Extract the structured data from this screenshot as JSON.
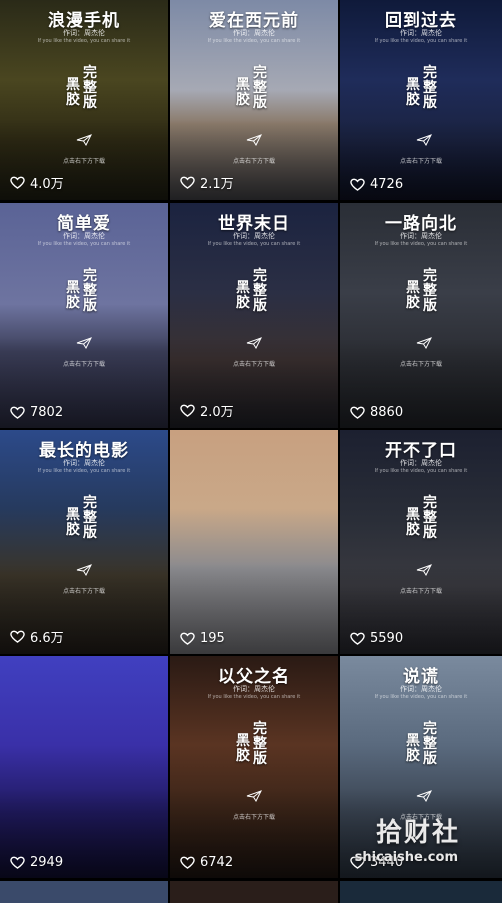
{
  "tiles": [
    {
      "title": "浪漫手机",
      "likes": "4.0万",
      "has_overlay": true,
      "bg": "linear-gradient(180deg,#2a2a18 0%,#4a4620 40%,#2e2a14 70%,#1a1a10 100%)"
    },
    {
      "title": "爱在西元前",
      "likes": "2.1万",
      "has_overlay": true,
      "bg": "linear-gradient(180deg,#7d8aa6 0%,#a6a9b4 45%,#8a7a6a 62%,#3a3a3e 100%)"
    },
    {
      "title": "回到过去",
      "likes": "4726",
      "has_overlay": true,
      "bg": "linear-gradient(180deg,#0f1a3a 0%,#1f2c5a 40%,#1a2240 70%,#0c0f1e 100%)"
    },
    {
      "title": "简单爱",
      "likes": "7802",
      "has_overlay": true,
      "bg": "linear-gradient(180deg,#5a6396 0%,#6e74a0 45%,#3c3f5a 66%,#26273a 100%)"
    },
    {
      "title": "世界末日",
      "likes": "2.0万",
      "has_overlay": true,
      "bg": "linear-gradient(180deg,#1b2340 0%,#2b2f44 40%,#3a3030 70%,#1c1c22 100%)"
    },
    {
      "title": "一路向北",
      "likes": "8860",
      "has_overlay": true,
      "bg": "linear-gradient(180deg,#2a2e36 0%,#3a3e48 40%,#2a2c32 70%,#1c1e22 100%)"
    },
    {
      "title": "最长的电影",
      "likes": "6.6万",
      "has_overlay": true,
      "bg": "linear-gradient(180deg,#2c4a8a 0%,#263a5e 35%,#3a3428 65%,#1e1a16 100%)"
    },
    {
      "title": "",
      "likes": "195",
      "has_overlay": false,
      "bg": "linear-gradient(180deg,#c8a080 0%,#c9a888 35%,#8a8a8e 62%,#6a6a6e 100%)"
    },
    {
      "title": "开不了口",
      "likes": "5590",
      "has_overlay": true,
      "bg": "linear-gradient(180deg,#1c2030 0%,#2a2e38 40%,#3a3a40 70%,#222228 100%)"
    },
    {
      "title": "",
      "likes": "2949",
      "has_overlay": false,
      "bg": "linear-gradient(180deg,#4040c0 0%,#3a30a8 40%,#201a60 70%,#0e0c2a 100%)"
    },
    {
      "title": "以父之名",
      "likes": "6742",
      "has_overlay": true,
      "bg": "linear-gradient(180deg,#2a1a14 0%,#5a3422 40%,#3a2418 70%,#1a120e 100%)"
    },
    {
      "title": "说谎",
      "likes": "3440",
      "has_overlay": true,
      "bg": "linear-gradient(180deg,#7a8a9e 0%,#5a6a7e 40%,#3a4452 70%,#222a34 100%)"
    }
  ],
  "overlay": {
    "sub_line": "作词：周杰伦",
    "sub_line2": "If you like the video, you can share it",
    "stamp_a": "黑胶",
    "stamp_b": "完整版",
    "cta": "点击右下方下载"
  },
  "watermark": {
    "cn": "拾财社",
    "url": "shicaishe.com"
  }
}
